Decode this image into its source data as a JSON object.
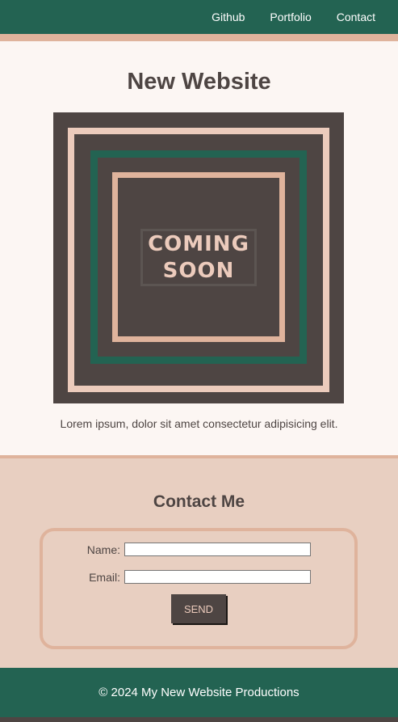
{
  "nav": {
    "links": [
      "Github",
      "Portfolio",
      "Contact"
    ]
  },
  "main": {
    "title": "New Website",
    "hero_line1": "COMING",
    "hero_line2": "SOON",
    "tagline": "Lorem ipsum, dolor sit amet consectetur adipisicing elit."
  },
  "contact": {
    "title": "Contact Me",
    "name_label": "Name:",
    "name_value": "",
    "email_label": "Email:",
    "email_value": "",
    "send_label": "SEND"
  },
  "footer": {
    "text": "© 2024 My New Website Productions"
  },
  "colors": {
    "dark_green": "#236352",
    "peach": "#dfb39c",
    "light_peach": "#e8cfc1",
    "cream": "#fcf6f3",
    "dark_brown": "#4e4543",
    "pale_pink": "#eccbbc"
  }
}
